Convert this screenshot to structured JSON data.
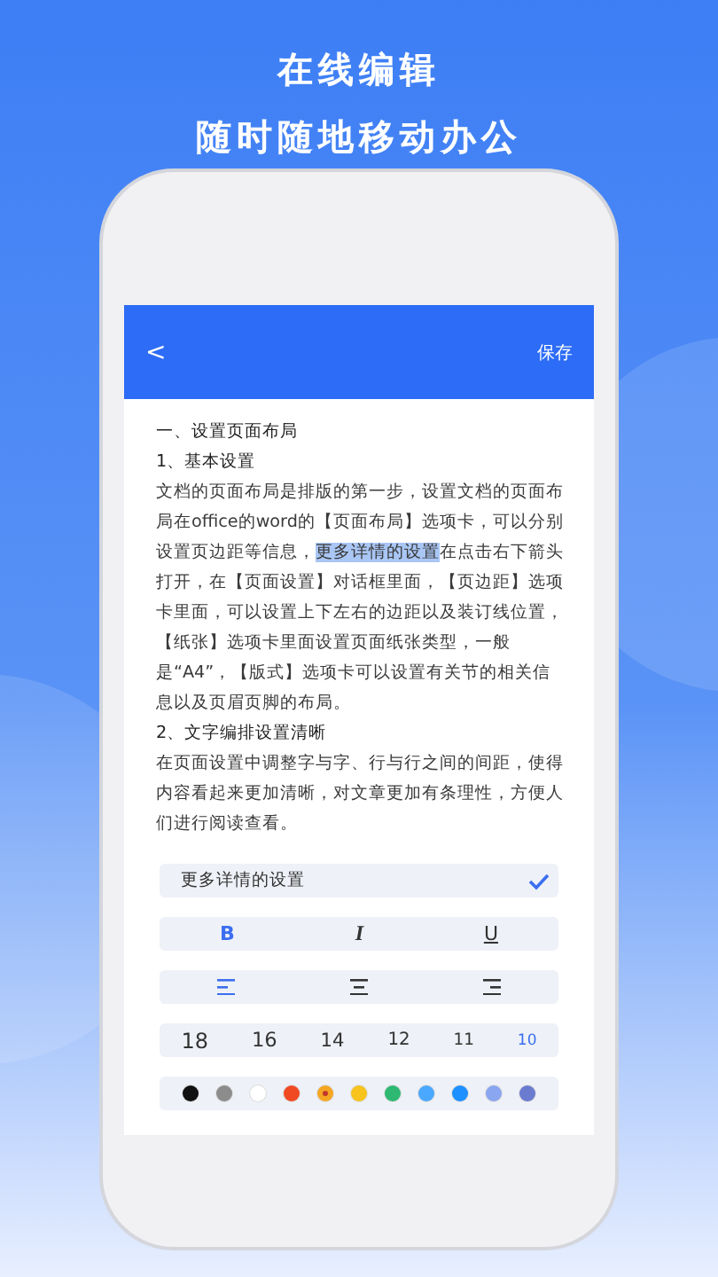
{
  "headline": [
    "在线编辑",
    "随时随地移动办公"
  ],
  "header": {
    "back": "<",
    "save": "保存"
  },
  "document": [
    {
      "kind": "heading",
      "segments": [
        {
          "text": "一、设置页面布局",
          "selected": false
        }
      ]
    },
    {
      "kind": "heading",
      "segments": [
        {
          "text": "1、基本设置",
          "selected": false
        }
      ]
    },
    {
      "kind": "paragraph",
      "segments": [
        {
          "text": "文档的页面布局是排版的第一步，设置文档的页面布局在office的word的【页面布局】选项卡，可以分别设置页边距等信息，",
          "selected": false
        },
        {
          "text": "更多详情的设置",
          "selected": true
        },
        {
          "text": "在点击右下箭头打开，在【页面设置】对话框里面，【页边距】选项卡里面，可以设置上下左右的边距以及装订线位置，【纸张】选项卡里面设置页面纸张类型，一般是“A4”，【版式】选项卡可以设置有关节的相关信息以及页眉页脚的布局。",
          "selected": false
        }
      ]
    },
    {
      "kind": "heading",
      "segments": [
        {
          "text": "2、文字编排设置清晰",
          "selected": false
        }
      ]
    },
    {
      "kind": "paragraph",
      "segments": [
        {
          "text": "在页面设置中调整字与字、行与行之间的间距，使得内容看起来更加清晰，对文章更加有条理性，方便人们进行阅读查看。",
          "selected": false
        }
      ]
    }
  ],
  "selection_bar": {
    "label": "更多详情的设置",
    "checked": true
  },
  "styles": [
    {
      "label": "B",
      "kind": "bold",
      "selected": true
    },
    {
      "label": "I",
      "kind": "italic",
      "selected": false
    },
    {
      "label": "U",
      "kind": "underline",
      "selected": false
    }
  ],
  "alignments": [
    {
      "kind": "left",
      "selected": true
    },
    {
      "kind": "center",
      "selected": false
    },
    {
      "kind": "right",
      "selected": false
    }
  ],
  "sizes": [
    {
      "label": "18",
      "selected": false
    },
    {
      "label": "16",
      "selected": false
    },
    {
      "label": "14",
      "selected": false
    },
    {
      "label": "12",
      "selected": false
    },
    {
      "label": "11",
      "selected": false
    },
    {
      "label": "10",
      "selected": true
    }
  ],
  "colors": [
    {
      "color": "#111111",
      "selected": false
    },
    {
      "color": "#8c8c8c",
      "selected": false
    },
    {
      "color": "#ffffff",
      "selected": false
    },
    {
      "color": "#f04a23",
      "selected": false
    },
    {
      "color": "#f5a623",
      "selected": true
    },
    {
      "color": "#f7c31c",
      "selected": false
    },
    {
      "color": "#2eb872",
      "selected": false
    },
    {
      "color": "#4aa8ff",
      "selected": false
    },
    {
      "color": "#1e90ff",
      "selected": false
    },
    {
      "color": "#8aa6f0",
      "selected": false
    },
    {
      "color": "#6a7bd0",
      "selected": false
    }
  ]
}
